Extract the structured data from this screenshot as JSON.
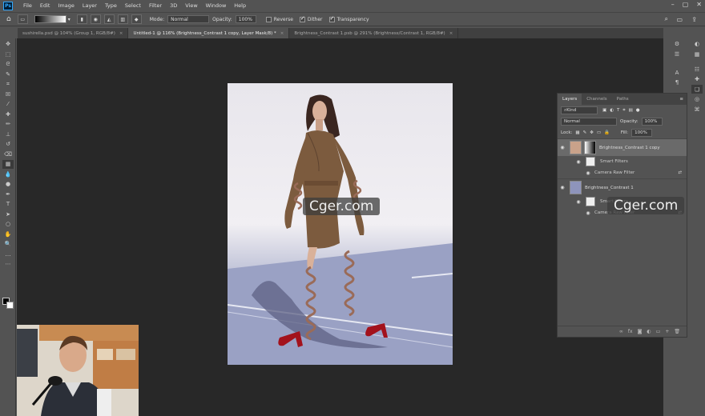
{
  "app": {
    "logo": "Ps"
  },
  "menu": [
    "File",
    "Edit",
    "Image",
    "Layer",
    "Type",
    "Select",
    "Filter",
    "3D",
    "View",
    "Window",
    "Help"
  ],
  "window_controls": [
    "–",
    "▢",
    "✕"
  ],
  "options": {
    "mode_label": "Mode:",
    "mode_value": "Normal",
    "opacity_label": "Opacity:",
    "opacity_value": "100%",
    "reverse_label": "Reverse",
    "dither_label": "Dither",
    "transparency_label": "Transparency"
  },
  "tabs": [
    {
      "label": "sushirella.psd @ 104% (Group 1, RGB/8#)",
      "active": false
    },
    {
      "label": "Untitled-1 @ 116% (Brightness_Contrast 1 copy, Layer Mask/8) *",
      "active": true
    },
    {
      "label": "Brightness_Contrast 1.psb @ 291% (Brightness/Contrast 1, RGB/8#)",
      "active": false
    }
  ],
  "watermarks": [
    "Cger.com",
    "Cger.com"
  ],
  "layers_panel": {
    "tabs": [
      "Layers",
      "Channels",
      "Paths"
    ],
    "kind_label": "Kind",
    "blend_mode": "Normal",
    "opacity_label": "Opacity:",
    "opacity_value": "100%",
    "lock_label": "Lock:",
    "fill_label": "Fill:",
    "fill_value": "100%",
    "layers": [
      {
        "name": "Brightness_Contrast 1 copy",
        "selected": true
      },
      {
        "name": "Smart Filters",
        "sub": true
      },
      {
        "name": "Camera Raw Filter",
        "sub": true
      },
      {
        "name": "Brightness_Contrast 1",
        "selected": false
      },
      {
        "name": "Smart Filters",
        "sub": true
      },
      {
        "name": "Camera Raw Filter",
        "sub": true
      }
    ],
    "bottom_icons": [
      "∞",
      "fx",
      "◙",
      "◐",
      "▭",
      "+",
      "🗑"
    ]
  },
  "colors": {
    "accent": "#31a8ff",
    "panel": "#535353",
    "canvas": "#282828"
  }
}
